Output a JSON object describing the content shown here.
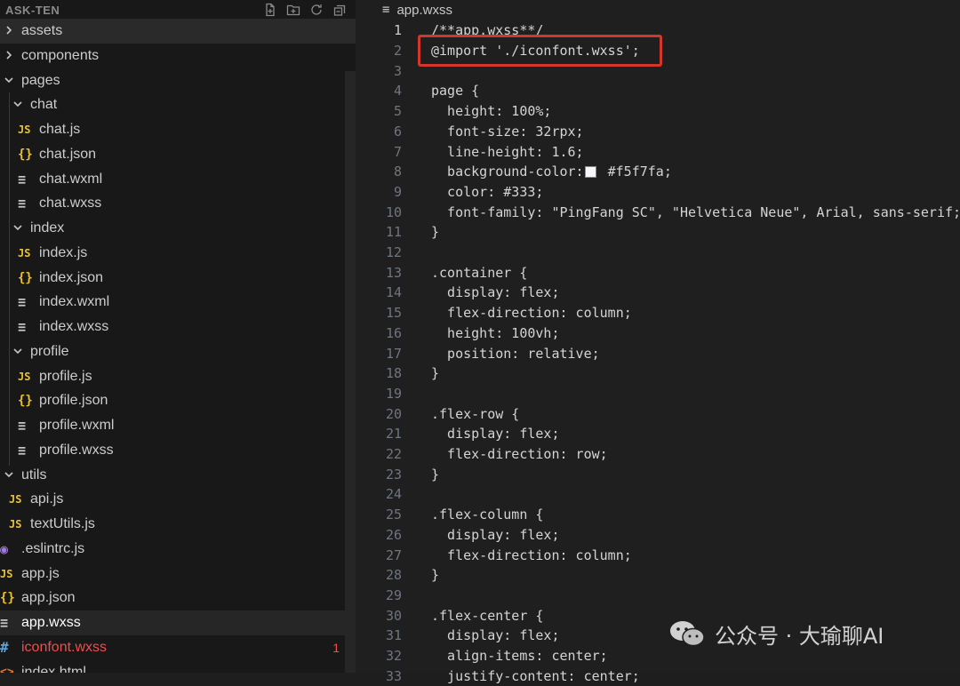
{
  "explorer": {
    "title": "ASK-TEN",
    "actions": [
      "new-file-icon",
      "new-folder-icon",
      "refresh-icon",
      "collapse-all-icon"
    ],
    "items": [
      {
        "label": "assets",
        "kind": "folder",
        "state": "collapsed",
        "indent": 0
      },
      {
        "label": "components",
        "kind": "folder",
        "state": "collapsed",
        "indent": 0
      },
      {
        "label": "pages",
        "kind": "folder",
        "state": "expanded",
        "indent": 0
      },
      {
        "label": "chat",
        "kind": "folder",
        "state": "expanded",
        "indent": 1
      },
      {
        "label": "chat.js",
        "kind": "js",
        "indent": 2
      },
      {
        "label": "chat.json",
        "kind": "json",
        "indent": 2
      },
      {
        "label": "chat.wxml",
        "kind": "lines",
        "indent": 2
      },
      {
        "label": "chat.wxss",
        "kind": "lines",
        "indent": 2
      },
      {
        "label": "index",
        "kind": "folder",
        "state": "expanded",
        "indent": 1
      },
      {
        "label": "index.js",
        "kind": "js",
        "indent": 2
      },
      {
        "label": "index.json",
        "kind": "json",
        "indent": 2
      },
      {
        "label": "index.wxml",
        "kind": "lines",
        "indent": 2
      },
      {
        "label": "index.wxss",
        "kind": "lines",
        "indent": 2
      },
      {
        "label": "profile",
        "kind": "folder",
        "state": "expanded",
        "indent": 1
      },
      {
        "label": "profile.js",
        "kind": "js",
        "indent": 2
      },
      {
        "label": "profile.json",
        "kind": "json",
        "indent": 2
      },
      {
        "label": "profile.wxml",
        "kind": "lines",
        "indent": 2
      },
      {
        "label": "profile.wxss",
        "kind": "lines",
        "indent": 2
      },
      {
        "label": "utils",
        "kind": "folder",
        "state": "expanded",
        "indent": 0
      },
      {
        "label": "api.js",
        "kind": "js",
        "indent": 1
      },
      {
        "label": "textUtils.js",
        "kind": "js",
        "indent": 1
      },
      {
        "label": ".eslintrc.js",
        "kind": "eslint",
        "indent": 0
      },
      {
        "label": "app.js",
        "kind": "js",
        "indent": 0
      },
      {
        "label": "app.json",
        "kind": "json",
        "indent": 0
      },
      {
        "label": "app.wxss",
        "kind": "lines",
        "indent": 0,
        "active": true
      },
      {
        "label": "iconfont.wxss",
        "kind": "hash",
        "indent": 0,
        "error": true,
        "badge": "1"
      },
      {
        "label": "index.html",
        "kind": "html",
        "indent": 0
      }
    ],
    "icon_glyphs": {
      "js": "JS",
      "json": "{}",
      "lines": "≡",
      "hash": "#",
      "eslint": "◉",
      "html": "<>"
    }
  },
  "editor": {
    "tab_title": "app.wxss",
    "current_line": 1,
    "lines": [
      "/**app.wxss**/",
      "@import './iconfont.wxss';",
      "",
      "page {",
      "  height: 100%;",
      "  font-size: 32rpx;",
      "  line-height: 1.6;",
      "  background-color: #f5f7fa;",
      "  color: #333;",
      "  font-family: \"PingFang SC\", \"Helvetica Neue\", Arial, sans-serif;",
      "}",
      "",
      ".container {",
      "  display: flex;",
      "  flex-direction: column;",
      "  height: 100vh;",
      "  position: relative;",
      "}",
      "",
      ".flex-row {",
      "  display: flex;",
      "  flex-direction: row;",
      "}",
      "",
      ".flex-column {",
      "  display: flex;",
      "  flex-direction: column;",
      "}",
      "",
      ".flex-center {",
      "  display: flex;",
      "  align-items: center;",
      "  justify-content: center;"
    ]
  },
  "colors": {
    "highlight_box": "#d3372a",
    "error": "#f14c4c",
    "js": "#e8c237",
    "swatch": "#f5f7fa"
  },
  "watermark": {
    "text": "公众号 · 大瑜聊AI"
  }
}
